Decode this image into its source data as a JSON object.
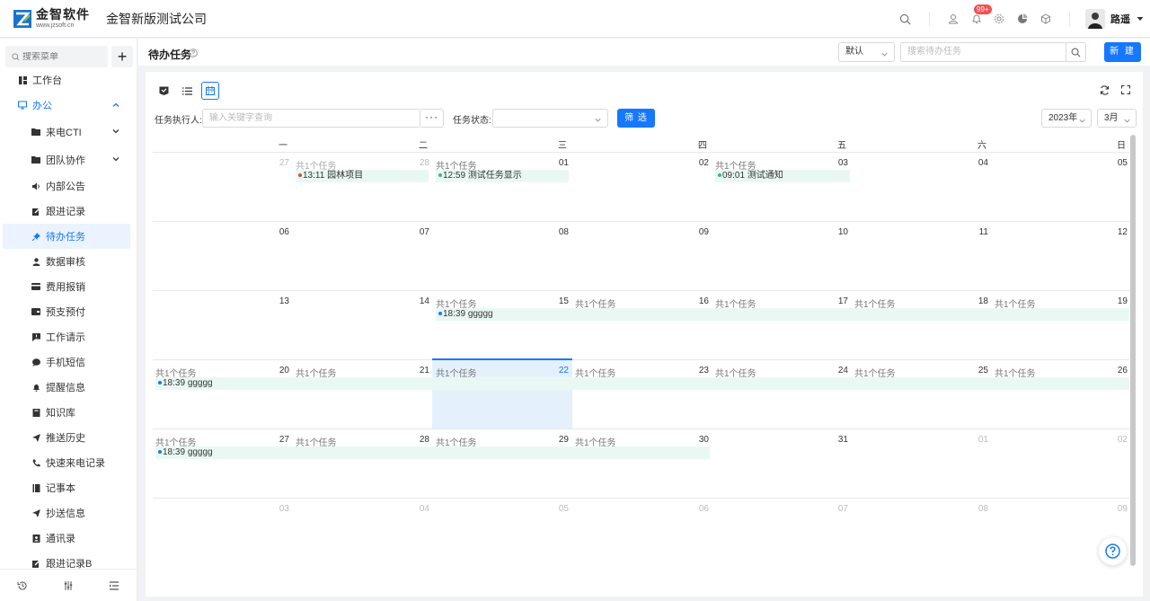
{
  "header": {
    "logo_cn": "金智软件",
    "logo_en": "www.jzsoft.cn",
    "company": "金智新版测试公司",
    "notification_badge": "99+",
    "username": "路遥",
    "colors": {
      "accent": "#1677ff",
      "badge": "#f5504f"
    }
  },
  "sidebar": {
    "search_placeholder": "搜索菜单",
    "add_label": "+",
    "items": [
      {
        "label": "工作台",
        "icon": "dashboard-icon"
      },
      {
        "label": "办公",
        "icon": "monitor-icon"
      },
      {
        "label": "来电CTI",
        "icon": "folder-icon"
      },
      {
        "label": "团队协作",
        "icon": "folder-icon"
      },
      {
        "label": "内部公告",
        "icon": "volume-icon"
      },
      {
        "label": "跟进记录",
        "icon": "edit-icon"
      },
      {
        "label": "待办任务",
        "icon": "pin-icon"
      },
      {
        "label": "数据审核",
        "icon": "person-icon"
      },
      {
        "label": "费用报销",
        "icon": "card-icon"
      },
      {
        "label": "预支预付",
        "icon": "wallet-icon"
      },
      {
        "label": "工作请示",
        "icon": "flag-icon"
      },
      {
        "label": "手机短信",
        "icon": "message-icon"
      },
      {
        "label": "提醒信息",
        "icon": "bell-icon"
      },
      {
        "label": "知识库",
        "icon": "book-icon"
      },
      {
        "label": "推送历史",
        "icon": "send-icon"
      },
      {
        "label": "快速来电记录",
        "icon": "phone-icon"
      },
      {
        "label": "记事本",
        "icon": "notebook-icon"
      },
      {
        "label": "抄送信息",
        "icon": "send-icon"
      },
      {
        "label": "通讯录",
        "icon": "contacts-icon"
      },
      {
        "label": "跟进记录B",
        "icon": "edit-icon"
      }
    ]
  },
  "page": {
    "title": "待办任务",
    "default_select": "默认",
    "search_placeholder": "搜索待办任务",
    "new_label": "新 建"
  },
  "filters": {
    "executor_label": "任务执行人:",
    "executor_placeholder": "输入关键字查询",
    "dots_label": "···",
    "status_label": "任务状态:",
    "status_value": "",
    "filter_button": "筛 选",
    "year": "2023年",
    "month": "3月"
  },
  "calendar": {
    "weekdays": [
      "一",
      "二",
      "三",
      "四",
      "五",
      "六",
      "日"
    ],
    "weeks": [
      [
        "27",
        "28",
        "01",
        "02",
        "03",
        "04",
        "05"
      ],
      [
        "06",
        "07",
        "08",
        "09",
        "10",
        "11",
        "12"
      ],
      [
        "13",
        "14",
        "15",
        "16",
        "17",
        "18",
        "19"
      ],
      [
        "20",
        "21",
        "22",
        "23",
        "24",
        "25",
        "26"
      ],
      [
        "27",
        "28",
        "29",
        "30",
        "31",
        "01",
        "02"
      ],
      [
        "03",
        "04",
        "05",
        "06",
        "07",
        "08",
        "09"
      ]
    ],
    "more_label": "共1个任务",
    "today": "22",
    "events": [
      {
        "time": "13:11",
        "title": "园林项目",
        "dot_color": "#e8463a"
      },
      {
        "time": "12:59",
        "title": "测试任务显示",
        "dot_color": "#3cb878"
      },
      {
        "time": "09:01",
        "title": "测试通知",
        "dot_color": "#3cb878"
      },
      {
        "time": "18:39",
        "title": "ggggg",
        "dot_color": "#1677ff"
      },
      {
        "time": "18:39",
        "title": "ggggg",
        "dot_color": "#1677ff"
      },
      {
        "time": "18:39",
        "title": "ggggg",
        "dot_color": "#1677ff"
      }
    ]
  }
}
